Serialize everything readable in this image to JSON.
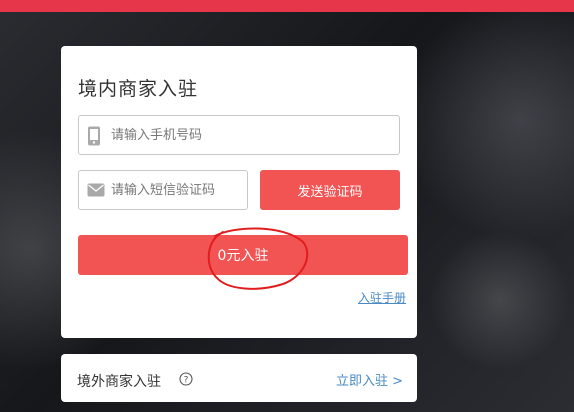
{
  "topbar": {
    "color": "#e6374a"
  },
  "domestic": {
    "title": "境内商家入驻",
    "phone_placeholder": "请输入手机号码",
    "code_placeholder": "请输入短信验证码",
    "send_code_label": "发送验证码",
    "submit_label": "0元入驻",
    "manual_link": "入驻手册",
    "accent_color": "#f25353"
  },
  "overseas": {
    "title": "境外商家入驻",
    "link_label": "立即入驻 >"
  },
  "icons": [
    "phone-icon",
    "message-icon",
    "help-icon"
  ]
}
